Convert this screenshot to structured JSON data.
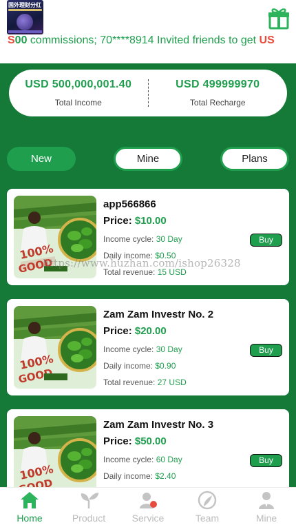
{
  "header": {
    "logo_text": "国外理财分红",
    "marquee": {
      "lead": "S",
      "num": "00",
      "text1": " commissions;  70****8914 Invited friends to get ",
      "tail": "US"
    }
  },
  "stats": {
    "income_value": "USD 500,000,001.40",
    "income_label": "Total Income",
    "recharge_value": "USD 499999970",
    "recharge_label": "Total Recharge"
  },
  "tabs": {
    "new": "New",
    "mine": "Mine",
    "plans": "Plans"
  },
  "labels": {
    "price": "Price: ",
    "cycle": "Income cycle: ",
    "daily": "Daily income: ",
    "revenue": "Total revenue: ",
    "buy": "Buy"
  },
  "products": [
    {
      "name": "app566866",
      "price": "$10.00",
      "cycle": "30 Day",
      "daily": "$0.50",
      "revenue": "15 USD"
    },
    {
      "name": "Zam Zam Investr No. 2",
      "price": "$20.00",
      "cycle": "30 Day",
      "daily": "$0.90",
      "revenue": "27 USD"
    },
    {
      "name": "Zam Zam Investr No. 3",
      "price": "$50.00",
      "cycle": "60 Day",
      "daily": "$2.40",
      "revenue": ""
    }
  ],
  "watermark": "https://www.huzhan.com/ishop26328",
  "nav": {
    "home": "Home",
    "product": "Product",
    "service": "Service",
    "team": "Team",
    "mine": "Mine"
  },
  "colors": {
    "primary_green": "#1f9e4e",
    "bg_green": "#157a37",
    "accent_red": "#e74c3c"
  }
}
